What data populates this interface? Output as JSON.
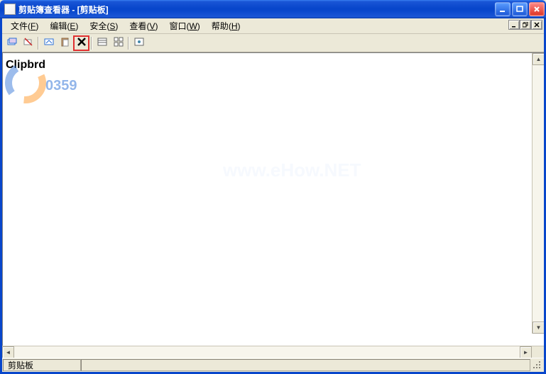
{
  "title": "剪贴簿查看器 - [剪贴板]",
  "menus": {
    "file": {
      "label": "文件",
      "hotkey": "F"
    },
    "edit": {
      "label": "编辑",
      "hotkey": "E"
    },
    "secure": {
      "label": "安全",
      "hotkey": "S"
    },
    "view": {
      "label": "查看",
      "hotkey": "V"
    },
    "window": {
      "label": "窗口",
      "hotkey": "W"
    },
    "help": {
      "label": "帮助",
      "hotkey": "H"
    }
  },
  "toolbar_icons": {
    "b1": "connect-icon",
    "b2": "disconnect-icon",
    "b3": "share-icon",
    "b4": "paste-icon",
    "b5": "delete-icon",
    "b6": "list-view-icon",
    "b7": "thumbnail-view-icon",
    "b8": "preview-icon"
  },
  "document": {
    "heading": "Clipbrd"
  },
  "status": {
    "pane1": "剪贴板"
  },
  "watermarks": {
    "faint": "www.eHow.NET",
    "side": "0359"
  }
}
